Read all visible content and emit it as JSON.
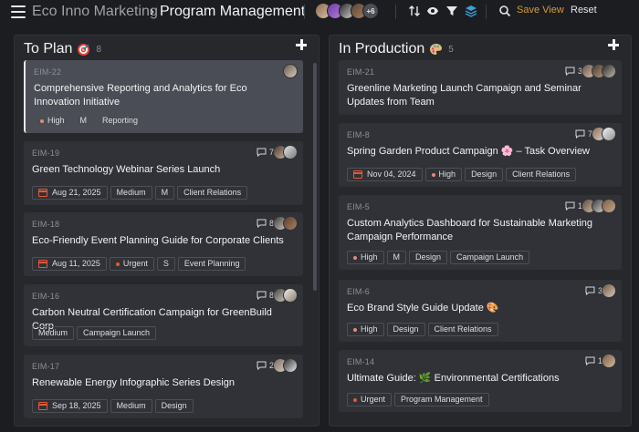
{
  "header": {
    "breadcrumb_parent": "Eco Inno Marketing",
    "separator": "›",
    "title": "Program Management",
    "avatars_more": "+6",
    "save_view": "Save View",
    "reset": "Reset",
    "icons": [
      "sort-icon",
      "eye-icon",
      "filter-icon",
      "layers-icon",
      "search-icon"
    ]
  },
  "colors": {
    "accent_orange": "#d89a3c",
    "priority_high": "#e08a7a",
    "priority_urgent": "#e05a3a",
    "calendar": "#e05a3a"
  },
  "columns": [
    {
      "title": "To Plan",
      "emoji": "target",
      "count": "8",
      "cards": [
        {
          "id": "EIM-22",
          "title": "Comprehensive Reporting and Analytics for Eco Innovation Initiative",
          "comments": "",
          "tags": [
            "High",
            "M",
            "Reporting"
          ]
        },
        {
          "id": "EIM-19",
          "title": "Green Technology Webinar Series Launch",
          "comments": "7",
          "date": "Aug 21, 2025",
          "tags": [
            "Medium",
            "M",
            "Client Relations"
          ]
        },
        {
          "id": "EIM-18",
          "title": "Eco-Friendly Event Planning Guide for Corporate Clients",
          "comments": "8",
          "date": "Aug 11, 2025",
          "tags": [
            "Urgent",
            "S",
            "Event Planning"
          ]
        },
        {
          "id": "EIM-16",
          "title": "Carbon Neutral Certification Campaign for GreenBuild Corp",
          "comments": "8",
          "tags": [
            "Medium",
            "Campaign Launch"
          ]
        },
        {
          "id": "EIM-17",
          "title": "Renewable Energy Infographic Series Design",
          "comments": "2",
          "date": "Sep 18, 2025",
          "tags": [
            "Medium",
            "Design"
          ]
        }
      ]
    },
    {
      "title": "In Production",
      "emoji": "palette",
      "count": "5",
      "cards": [
        {
          "id": "EIM-21",
          "title": "Greenline Marketing Launch Campaign and Seminar Updates from Team",
          "comments": "3",
          "tags": []
        },
        {
          "id": "EIM-8",
          "title": "Spring Garden Product Campaign 🌸 – Task Overview",
          "comments": "7",
          "date": "Nov 04, 2024",
          "tags": [
            "High",
            "Design",
            "Client Relations"
          ]
        },
        {
          "id": "EIM-5",
          "title": "Custom Analytics Dashboard for Sustainable Marketing Campaign Performance",
          "comments": "1",
          "tags": [
            "High",
            "M",
            "Design",
            "Campaign Launch"
          ]
        },
        {
          "id": "EIM-6",
          "title": "Eco Brand Style Guide Update 🎨",
          "comments": "3",
          "tags": [
            "High",
            "Design",
            "Client Relations"
          ]
        },
        {
          "id": "EIM-14",
          "title": "Ultimate Guide: 🌿 Environmental Certifications",
          "comments": "1",
          "tags": [
            "Urgent",
            "Program Management"
          ]
        }
      ]
    }
  ]
}
